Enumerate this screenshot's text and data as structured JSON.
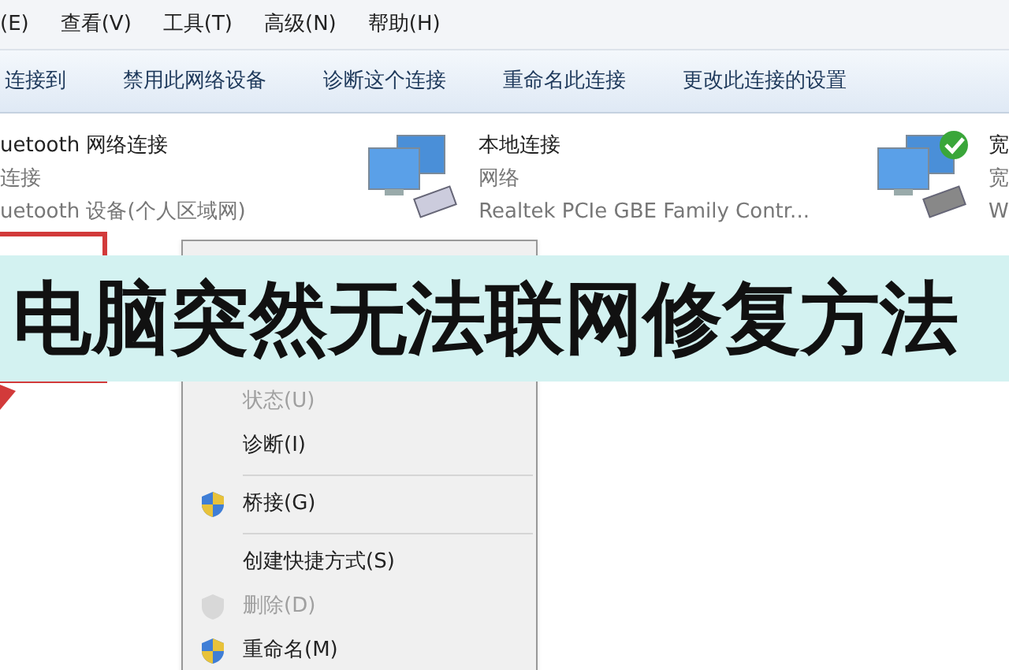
{
  "menu_bar": [
    {
      "label": "(E)"
    },
    {
      "label": "查看(V)"
    },
    {
      "label": "工具(T)"
    },
    {
      "label": "高级(N)"
    },
    {
      "label": "帮助(H)"
    }
  ],
  "toolbar": [
    {
      "label": "连接到"
    },
    {
      "label": "禁用此网络设备"
    },
    {
      "label": "诊断这个连接"
    },
    {
      "label": "重命名此连接"
    },
    {
      "label": "更改此连接的设置"
    }
  ],
  "connections": [
    {
      "name": "uetooth 网络连接",
      "status": "连接",
      "device": "uetooth 设备(个人区域网)",
      "kind": "text-only"
    },
    {
      "name": "本地连接",
      "status": "网络",
      "device": "Realtek PCIe GBE Family Contr...",
      "kind": "computer",
      "connected": false
    },
    {
      "name": "宽",
      "status": "宽",
      "device": "W",
      "kind": "computer",
      "connected": true
    }
  ],
  "banner": {
    "title": "电脑突然无法联网修复方法"
  },
  "context_menu": [
    {
      "kind": "item",
      "label": "状态(U)",
      "disabled": true,
      "shielded": false
    },
    {
      "kind": "item",
      "label": "诊断(I)",
      "disabled": false,
      "shielded": false
    },
    {
      "kind": "separator"
    },
    {
      "kind": "item",
      "label": "桥接(G)",
      "disabled": false,
      "shielded": true
    },
    {
      "kind": "separator"
    },
    {
      "kind": "item",
      "label": "创建快捷方式(S)",
      "disabled": false,
      "shielded": false
    },
    {
      "kind": "item",
      "label": "删除(D)",
      "disabled": true,
      "shielded": true
    },
    {
      "kind": "item",
      "label": "重命名(M)",
      "disabled": false,
      "shielded": true
    }
  ]
}
